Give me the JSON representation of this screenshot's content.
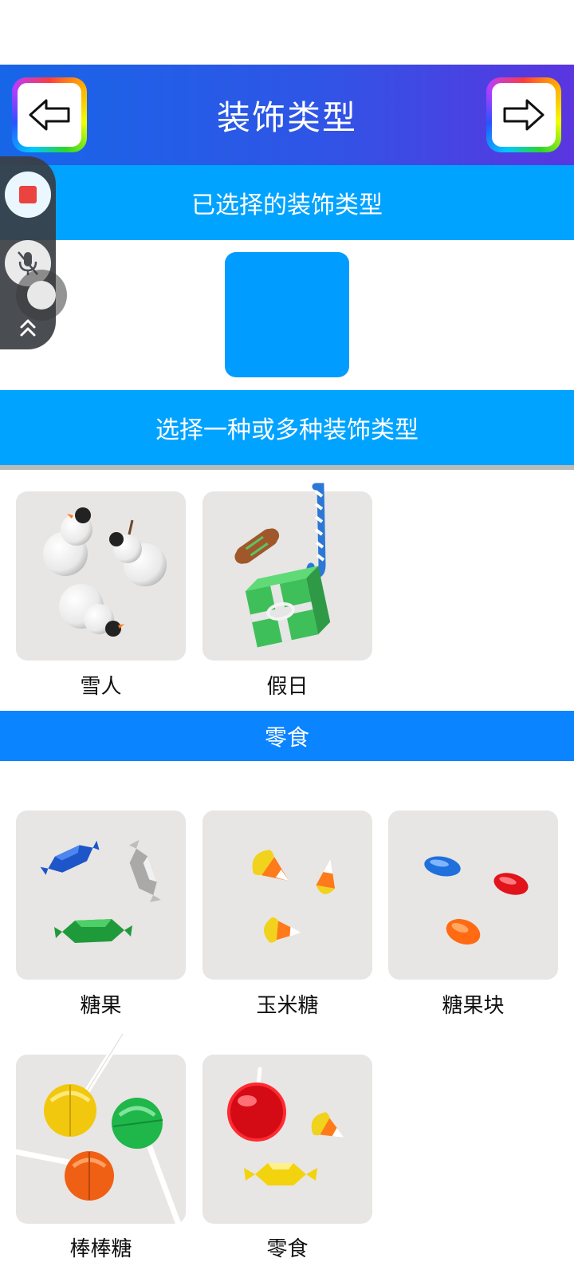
{
  "header": {
    "title": "装饰类型",
    "prev_icon": "arrow-left-icon",
    "next_icon": "arrow-right-icon"
  },
  "selected_section": {
    "title": "已选择的装饰类型",
    "swatch_color": "#009cff"
  },
  "choose_section": {
    "title": "选择一种或多种装饰类型",
    "items": [
      {
        "label": "雪人",
        "icon": "snowman-icon"
      },
      {
        "label": "假日",
        "icon": "holiday-icon"
      }
    ]
  },
  "snack_section": {
    "title": "零食",
    "items": [
      {
        "label": "糖果",
        "icon": "wrapped-candy-icon"
      },
      {
        "label": "玉米糖",
        "icon": "candy-corn-icon"
      },
      {
        "label": "糖果块",
        "icon": "candy-pieces-icon"
      },
      {
        "label": "棒棒糖",
        "icon": "lollipop-icon"
      },
      {
        "label": "零食",
        "icon": "snacks-icon"
      }
    ]
  },
  "recorder_widget": {
    "record_icon": "stop-record-icon",
    "mic_icon": "mic-muted-icon",
    "expand_icon": "double-chevron-up-icon"
  },
  "colors": {
    "header_gradient_start": "#1766e8",
    "header_gradient_end": "#5a35e0",
    "band_blue": "#00a3ff",
    "snack_band_blue": "#0a84ff",
    "tile_bg": "#e7e6e4"
  }
}
